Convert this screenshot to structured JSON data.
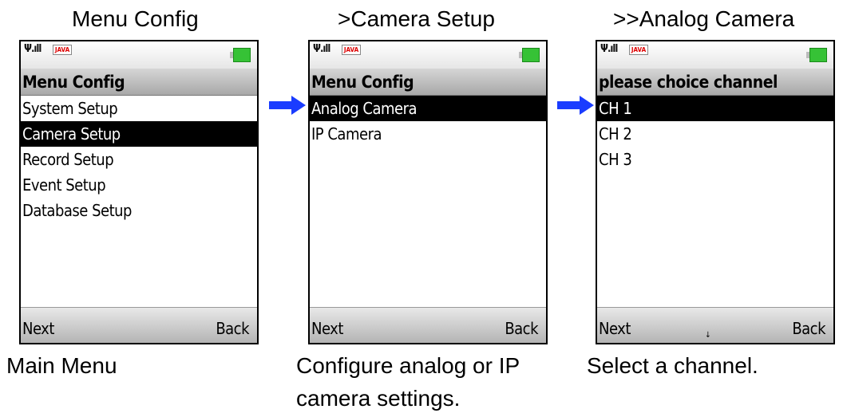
{
  "headings": [
    "Menu Config",
    ">Camera Setup",
    ">>Analog Camera"
  ],
  "captions": [
    [
      "Main Menu"
    ],
    [
      "Configure analog or IP",
      "camera settings."
    ],
    [
      "Select a channel."
    ]
  ],
  "screens": [
    {
      "title": "Menu Config",
      "items": [
        "System Setup",
        "Camera Setup",
        "Record Setup",
        "Event Setup",
        "Database Setup"
      ],
      "selected_item": "Camera Setup",
      "soft_left": "Next",
      "soft_right": "Back"
    },
    {
      "title": "Menu Config",
      "items": [
        "Analog Camera",
        "IP Camera"
      ],
      "selected_item": "Analog Camera",
      "soft_left": "Next",
      "soft_right": "Back"
    },
    {
      "title": "please choice channel",
      "items": [
        "CH 1",
        "CH 2",
        "CH 3"
      ],
      "selected_item": "CH 1",
      "soft_left": "Next",
      "soft_right": "Back",
      "scroll_indicator": "↓"
    }
  ],
  "status_bar": {
    "signal_icon": "signal-bars-icon",
    "java_logo": "JAVA",
    "battery_icon": "battery-full-icon"
  },
  "colors": {
    "selection_bg": "#000000",
    "selection_fg": "#ffffff",
    "arrow": "#1a3cff",
    "battery": "#36c236"
  }
}
